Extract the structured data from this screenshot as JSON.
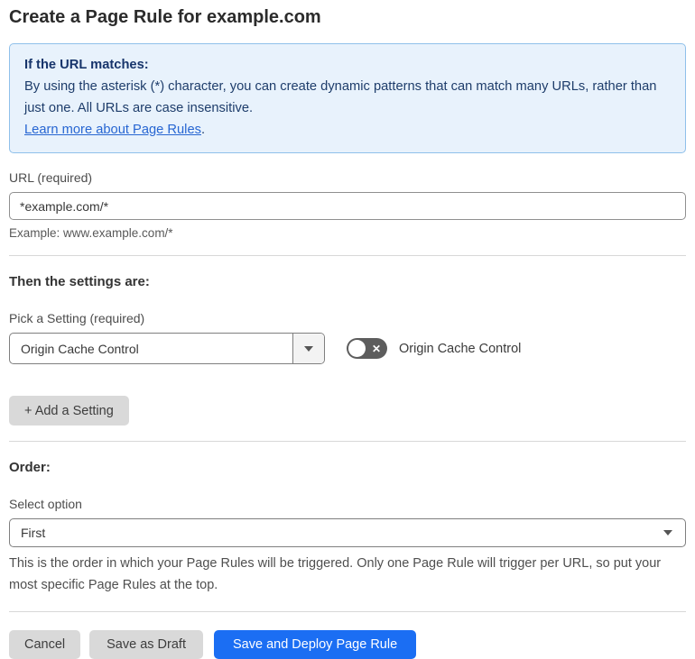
{
  "page": {
    "title": "Create a Page Rule for example.com"
  },
  "info_box": {
    "heading": "If the URL matches:",
    "body": "By using the asterisk (*) character, you can create dynamic patterns that can match many URLs, rather than just one. All URLs are case insensitive.",
    "link_label": "Learn more about Page Rules",
    "link_suffix": "."
  },
  "url_field": {
    "label": "URL (required)",
    "value": "*example.com/*",
    "example": "Example: www.example.com/*"
  },
  "settings_section": {
    "heading": "Then the settings are:",
    "picker_label": "Pick a Setting (required)",
    "picker_value": "Origin Cache Control",
    "toggle_state": "off",
    "toggle_x_glyph": "✕",
    "toggle_label": "Origin Cache Control",
    "add_button_label": "+ Add a Setting"
  },
  "order_section": {
    "heading": "Order:",
    "select_label": "Select option",
    "select_value": "First",
    "help": "This is the order in which your Page Rules will be triggered. Only one Page Rule will trigger per URL, so put your most specific Page Rules at the top."
  },
  "footer": {
    "cancel_label": "Cancel",
    "save_draft_label": "Save as Draft",
    "save_deploy_label": "Save and Deploy Page Rule"
  },
  "colors": {
    "primary_button": "#1b6ef3",
    "info_box_bg": "#e8f2fc",
    "info_box_border": "#8fc0ea",
    "info_text": "#1e3d6b",
    "link": "#2766d2",
    "toggle_off_bg": "#5d5d5d"
  }
}
